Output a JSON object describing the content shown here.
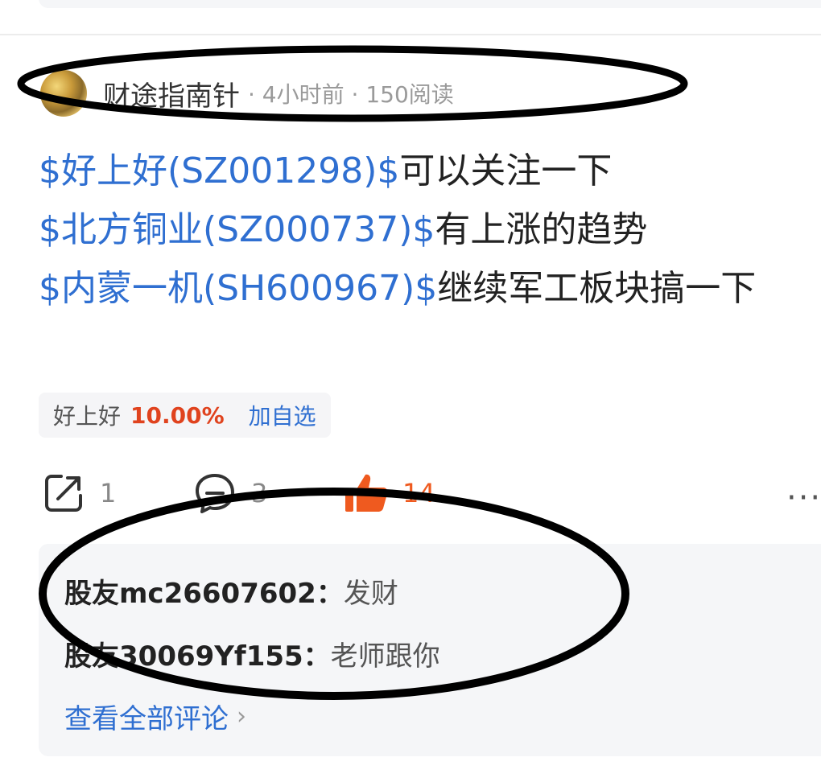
{
  "post": {
    "author": "财途指南针",
    "meta": "· 4小时前 · 150阅读",
    "lines": [
      {
        "link": "$好上好(SZ001298)$",
        "text": "可以关注一下"
      },
      {
        "link": "$北方铜业(SZ000737)$",
        "text": "有上涨的趋势"
      },
      {
        "link": "$内蒙一机(SH600967)$",
        "text": "继续军工板块搞一下"
      }
    ]
  },
  "quote": {
    "name": "好上好",
    "change": "10.00%",
    "add_label": "加自选",
    "change_color": "#e0431e"
  },
  "actions": {
    "share_count": "1",
    "comment_count": "3",
    "like_count": "14",
    "like_color": "#ef5a1f",
    "more_label": "···"
  },
  "comments": [
    {
      "user": "股友mc26607602",
      "text": "发财"
    },
    {
      "user": "股友30069Yf155",
      "text": "老师跟你"
    }
  ],
  "view_all": {
    "label": "查看全部评论",
    "chevron": "›"
  },
  "icons": {
    "share": "share-icon",
    "comment": "comment-bubble-icon",
    "like": "thumbs-up-icon"
  }
}
